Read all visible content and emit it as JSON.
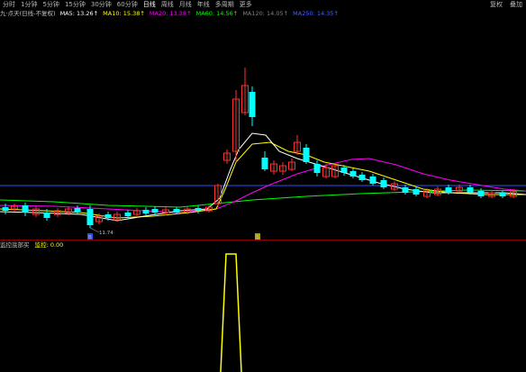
{
  "toolbar": {
    "tabs": [
      "分时",
      "1分钟",
      "5分钟",
      "15分钟",
      "30分钟",
      "60分钟",
      "日线",
      "周线",
      "月线",
      "年线",
      "多周期",
      "更多"
    ],
    "active_index": 6,
    "right": [
      "复权",
      "叠加"
    ]
  },
  "ma_legend": {
    "title": "九·点天(日线-不复权)",
    "items": [
      {
        "label": "MA5: 13.26↑",
        "color": "#ffffff"
      },
      {
        "label": "MA10: 15.38↑",
        "color": "#ffff00"
      },
      {
        "label": "MA20: 13.38↑",
        "color": "#ff00ff"
      },
      {
        "label": "MA60: 14.56↑",
        "color": "#00ff00"
      },
      {
        "label": "MA120: 14.05↑",
        "color": "#808080"
      },
      {
        "label": "MA250: 14.35↑",
        "color": "#4060ff"
      }
    ]
  },
  "price_label": "11.74",
  "markers": {
    "b": "B",
    "s": "S"
  },
  "indicator": {
    "name": "监控底部买",
    "label": "监控: 0.00",
    "name_color": "#c0c0c0",
    "label_color": "#ffff00"
  },
  "colors": {
    "up": "#ff3030",
    "down": "#00ffff",
    "ma5": "#ffffff",
    "ma10": "#ffff00",
    "ma20": "#ff00ff",
    "ma60": "#00ff00",
    "ma250": "#3050ff",
    "signal": "#ffff00"
  }
}
